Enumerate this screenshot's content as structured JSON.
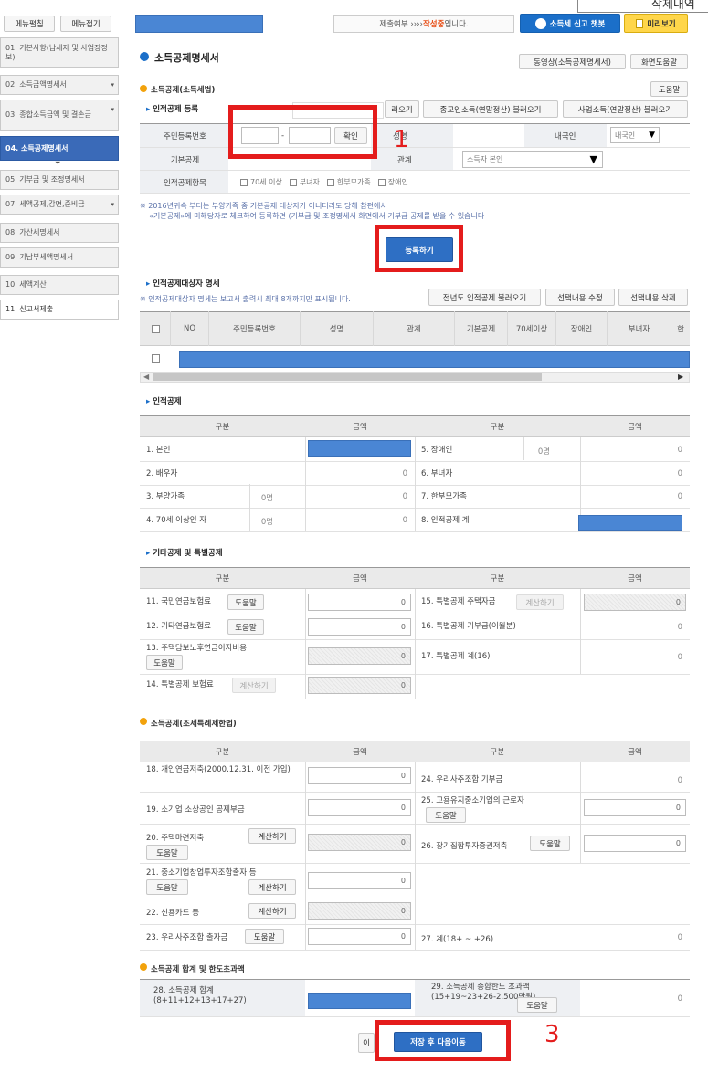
{
  "top": {
    "menu_toggle_left": "메뉴펼침",
    "menu_toggle_right": "메뉴접기",
    "status_text": "제출여부 ›››› ",
    "status_strong": "작성중",
    "status_tail": "입니다.",
    "chatbot": "소득세 신고 챗봇",
    "preview": "미리보기",
    "corner": "삭제내역"
  },
  "sidebar": [
    {
      "label": "01. 기본사항(납세자 및 사업장정보)",
      "dd": false
    },
    {
      "label": "02. 소득금액명세서",
      "dd": true
    },
    {
      "label": "03. 종합소득금액 및 결손금",
      "dd": true
    },
    {
      "label": "04. 소득공제명세서",
      "dd": false,
      "active": true
    },
    {
      "label": "05. 기부금 및 조정명세서",
      "dd": false
    },
    {
      "label": "07. 세액공제,감면,준비금",
      "dd": true
    },
    {
      "label": "08. 가산세명세서",
      "dd": false
    },
    {
      "label": "09. 기납부세액명세서",
      "dd": false
    },
    {
      "label": "10. 세액계산",
      "dd": false
    },
    {
      "label": "11. 신고서제출",
      "dd": false
    }
  ],
  "page": {
    "title": "소득공제명세서",
    "video_btn": "동영상(소득공제명세서)",
    "help_btn": "화면도움말"
  },
  "section1": {
    "title": "소득공제(소득세법)",
    "help": "도움말"
  },
  "reg": {
    "title": "인적공제 등록",
    "load1": "러오기",
    "load2": "종교인소득(연말정산) 불러오기",
    "load3": "사업소득(연말정산) 불러오기",
    "rrn_label": "주민등록번호",
    "dash": "-",
    "confirm": "확인",
    "name_label": "성명",
    "nat_label": "내국인",
    "nat_value": "내국인",
    "basic_label": "기본공제",
    "rel_label": "관계",
    "rel_value": "소득자 본인",
    "extra_label": "인적공제항목",
    "checks": [
      "70세 이상",
      "부녀자",
      "한부모가족",
      "장애인"
    ],
    "notice1": "※ 2016년귀속 부터는 부양가족 중 기본공제 대상자가 아니더라도 당해 참편에서",
    "notice2": "«기본공제»에 미해당자로 체크하여 등록하면 (기부금 및 조정명세서 화면에서 기부금 공제를 받을 수 있습니다",
    "register_btn": "등록하기"
  },
  "list": {
    "title": "인적공제대상자 명세",
    "note": "※ 인적공제대상자 명세는 보고서 출력시 최대 8개까지만 표시됩니다.",
    "btn_prev": "전년도 인적공제 불러오기",
    "btn_edit": "선택내용 수정",
    "btn_del": "선택내용 삭제",
    "headers": [
      "NO",
      "주민등록번호",
      "성명",
      "관계",
      "기본공제",
      "70세이상",
      "장애인",
      "부녀자",
      "한"
    ]
  },
  "personal": {
    "title": "인적공제",
    "h_gubun": "구분",
    "h_amount": "금액",
    "left": [
      {
        "label": "1. 본인",
        "count": "",
        "amount": ""
      },
      {
        "label": "2. 배우자",
        "count": "",
        "amount": "0"
      },
      {
        "label": "3. 부양가족",
        "count": "0명",
        "amount": "0"
      },
      {
        "label": "4. 70세 이상인 자",
        "count": "0명",
        "amount": "0"
      }
    ],
    "right": [
      {
        "label": "5. 장애인",
        "count": "0명",
        "amount": "0"
      },
      {
        "label": "6. 부녀자",
        "count": "",
        "amount": "0"
      },
      {
        "label": "7. 한부모가족",
        "count": "",
        "amount": "0"
      },
      {
        "label": "8. 인적공제 계",
        "count": "",
        "amount": ""
      }
    ]
  },
  "other": {
    "title": "기타공제 및 특별공제",
    "r11": "11. 국민연금보험료",
    "r12": "12. 기타연금보험료",
    "r13": "13. 주택담보노후연금이자비용",
    "r14": "14. 특별공제 보험료",
    "r15": "15. 특별공제 주택자금",
    "r16": "16. 특별공제 기부금(이월분)",
    "r17": "17. 특별공제 계(16)",
    "help": "도움말",
    "calc": "계산하기",
    "zero": "0"
  },
  "section2": {
    "title": "소득공제(조세특례제한법)",
    "r18": "18. 개인연금저축(2000.12.31. 이전 가입)",
    "r19": "19. 소기업 소상공인 공제부금",
    "r20": "20. 주택마련저축",
    "r21": "21. 중소기업창업투자조합출자 등",
    "r22": "22. 신용카드 등",
    "r23": "23. 우리사주조합 출자금",
    "r24": "24. 우리사주조합 기부금",
    "r25": "25. 고용유지중소기업의 근로자",
    "r26": "26. 장기집합투자증권저축",
    "r27": "27. 계(18+ ~ +26)"
  },
  "section3": {
    "title": "소득공제 합계 및 한도초과액",
    "r28": "28. 소득공제 합계(8+11+12+13+17+27)",
    "r29": "29. 소득공제 종합한도 초과액(15+19~23+26-2,500만원)",
    "zero": "0"
  },
  "footer": {
    "small_btn": "이",
    "save_btn": "저장 후 다음이동"
  },
  "annotations": {
    "n1": "1",
    "n3": "3"
  }
}
